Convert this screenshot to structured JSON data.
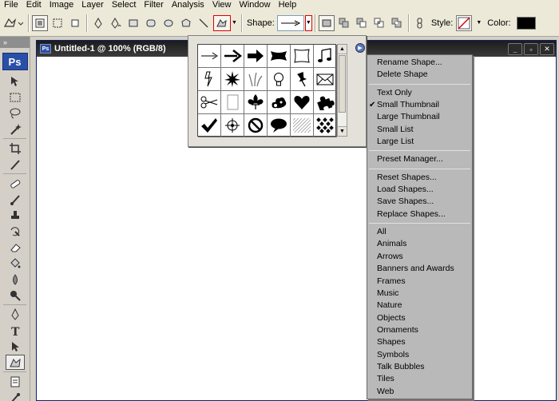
{
  "menubar": [
    "File",
    "Edit",
    "Image",
    "Layer",
    "Select",
    "Filter",
    "Analysis",
    "View",
    "Window",
    "Help"
  ],
  "options": {
    "shape_label": "Shape:",
    "style_label": "Style:",
    "color_label": "Color:",
    "color_value": "#000000",
    "shape_value": "arrow"
  },
  "toolbox": {
    "logo": "Ps"
  },
  "document": {
    "title": "Untitled-1 @ 100% (RGB/8)"
  },
  "picker": {
    "shapes": [
      "arrow-thin",
      "arrow-medium",
      "arrow-bold",
      "banner",
      "frame",
      "music-note",
      "lightning",
      "starburst",
      "grass",
      "light-bulb",
      "pushpin",
      "envelope",
      "scissors",
      "blank-page",
      "fleur-de-lis",
      "ornament",
      "heart",
      "puzzle-piece",
      "checkmark",
      "target",
      "no-sign",
      "speech-bubble",
      "diagonal-tile",
      "checker-tile"
    ]
  },
  "menu": {
    "group1": [
      "Rename Shape...",
      "Delete Shape"
    ],
    "group2": [
      {
        "label": "Text Only",
        "checked": false
      },
      {
        "label": "Small Thumbnail",
        "checked": true
      },
      {
        "label": "Large Thumbnail",
        "checked": false
      },
      {
        "label": "Small List",
        "checked": false
      },
      {
        "label": "Large List",
        "checked": false
      }
    ],
    "group3": [
      "Preset Manager..."
    ],
    "group4": [
      "Reset Shapes...",
      "Load Shapes...",
      "Save Shapes...",
      "Replace Shapes..."
    ],
    "group5": [
      "All",
      "Animals",
      "Arrows",
      "Banners and Awards",
      "Frames",
      "Music",
      "Nature",
      "Objects",
      "Ornaments",
      "Shapes",
      "Symbols",
      "Talk Bubbles",
      "Tiles",
      "Web"
    ]
  }
}
